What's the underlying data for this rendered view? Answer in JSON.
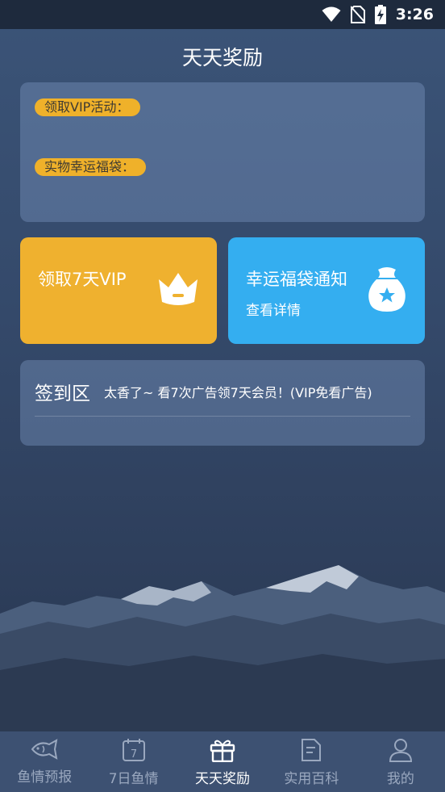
{
  "status_bar": {
    "time": "3:26"
  },
  "page": {
    "title": "天天奖励"
  },
  "promo": {
    "vip_activity_label": "领取VIP活动：",
    "lucky_bag_label": "实物幸运福袋："
  },
  "cards": {
    "vip": {
      "title": "领取7天VIP",
      "icon": "crown-icon",
      "color": "#efb12f"
    },
    "lucky": {
      "title": "幸运福袋通知",
      "subtitle": "查看详情",
      "icon": "lucky-bag-icon",
      "color": "#34aef0"
    }
  },
  "signin": {
    "title": "签到区",
    "description": "太香了~ 看7次广告领7天会员！(VIP免看广告)"
  },
  "tabs": [
    {
      "label": "鱼情预报",
      "icon": "fish-icon",
      "active": false
    },
    {
      "label": "7日鱼情",
      "icon": "calendar-icon",
      "active": false
    },
    {
      "label": "天天奖励",
      "icon": "gift-icon",
      "active": true
    },
    {
      "label": "实用百科",
      "icon": "book-icon",
      "active": false
    },
    {
      "label": "我的",
      "icon": "user-icon",
      "active": false
    }
  ]
}
